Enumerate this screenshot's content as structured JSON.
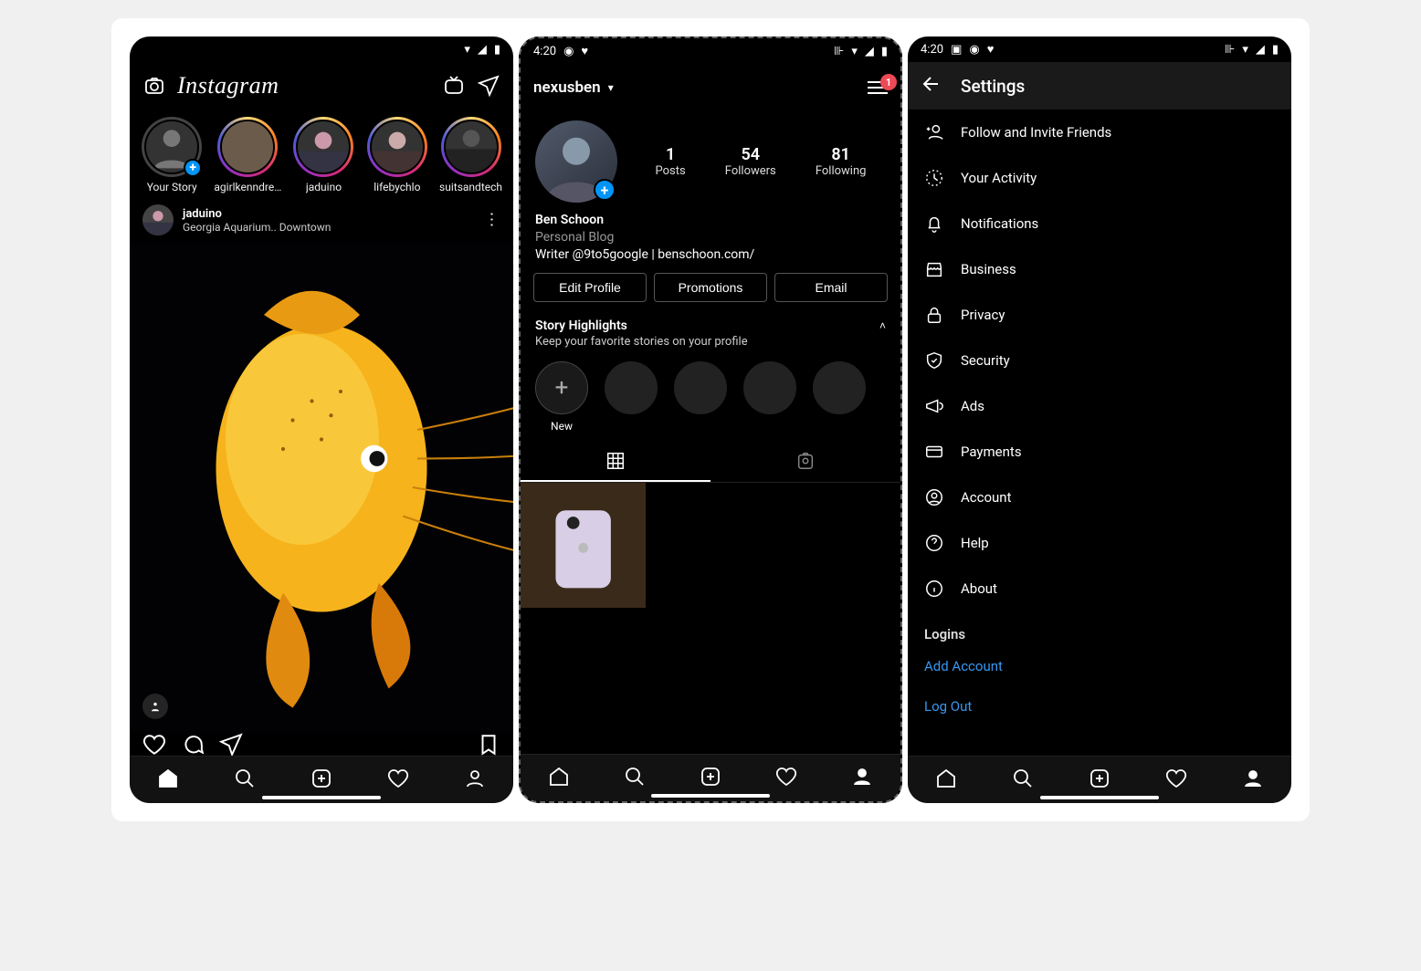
{
  "status": {
    "time": "4:20"
  },
  "feed": {
    "logo": "Instagram",
    "stories": [
      {
        "label": "Your Story",
        "own": true
      },
      {
        "label": "agirlkenndre…"
      },
      {
        "label": "jaduino"
      },
      {
        "label": "lifebychlo"
      },
      {
        "label": "suitsandtech"
      }
    ],
    "post": {
      "user": "jaduino",
      "location": "Georgia Aquarium.. Downtown"
    }
  },
  "profile": {
    "username": "nexusben",
    "menu_badge": "1",
    "stats": {
      "posts": {
        "num": "1",
        "label": "Posts"
      },
      "followers": {
        "num": "54",
        "label": "Followers"
      },
      "following": {
        "num": "81",
        "label": "Following"
      }
    },
    "name": "Ben Schoon",
    "category": "Personal Blog",
    "bio": "Writer @9to5google | benschoon.com/",
    "buttons": {
      "edit": "Edit Profile",
      "promo": "Promotions",
      "email": "Email"
    },
    "highlights": {
      "title": "Story Highlights",
      "subtitle": "Keep your favorite stories on your profile",
      "new_label": "New"
    }
  },
  "settings": {
    "title": "Settings",
    "items": [
      "Follow and Invite Friends",
      "Your Activity",
      "Notifications",
      "Business",
      "Privacy",
      "Security",
      "Ads",
      "Payments",
      "Account",
      "Help",
      "About"
    ],
    "logins_header": "Logins",
    "add_account": "Add Account",
    "log_out": "Log Out"
  }
}
